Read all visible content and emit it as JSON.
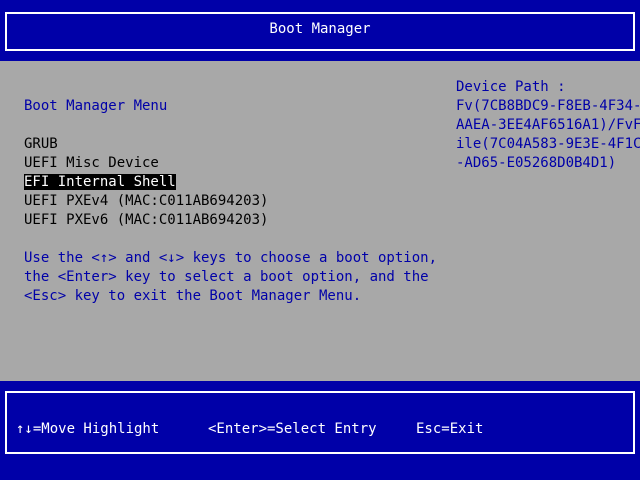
{
  "header": {
    "title": "Boot Manager"
  },
  "menu": {
    "title": "Boot Manager Menu",
    "items": [
      {
        "label": "GRUB",
        "selected": false
      },
      {
        "label": "UEFI Misc Device",
        "selected": false
      },
      {
        "label": "EFI Internal Shell",
        "selected": true
      },
      {
        "label": "UEFI PXEv4 (MAC:C011AB694203)",
        "selected": false
      },
      {
        "label": "UEFI PXEv6 (MAC:C011AB694203)",
        "selected": false
      }
    ]
  },
  "help": {
    "lines": [
      "Use the <↑> and <↓> keys to choose a boot option,",
      "the <Enter> key to select a boot option, and the",
      "<Esc> key to exit the Boot Manager Menu."
    ]
  },
  "device_path": {
    "label": "Device Path :",
    "lines": [
      "Fv(7CB8BDC9-F8EB-4F34-",
      "AAEA-3EE4AF6516A1)/FvF",
      "ile(7C04A583-9E3E-4F1C",
      "-AD65-E05268D0B4D1)"
    ]
  },
  "footer": {
    "move": "↑↓=Move Highlight",
    "select": "<Enter>=Select Entry",
    "exit": "Esc=Exit"
  },
  "colors": {
    "blue": "#0000a8",
    "gray": "#a8a8a8",
    "white": "#ffffff",
    "black": "#000000"
  }
}
